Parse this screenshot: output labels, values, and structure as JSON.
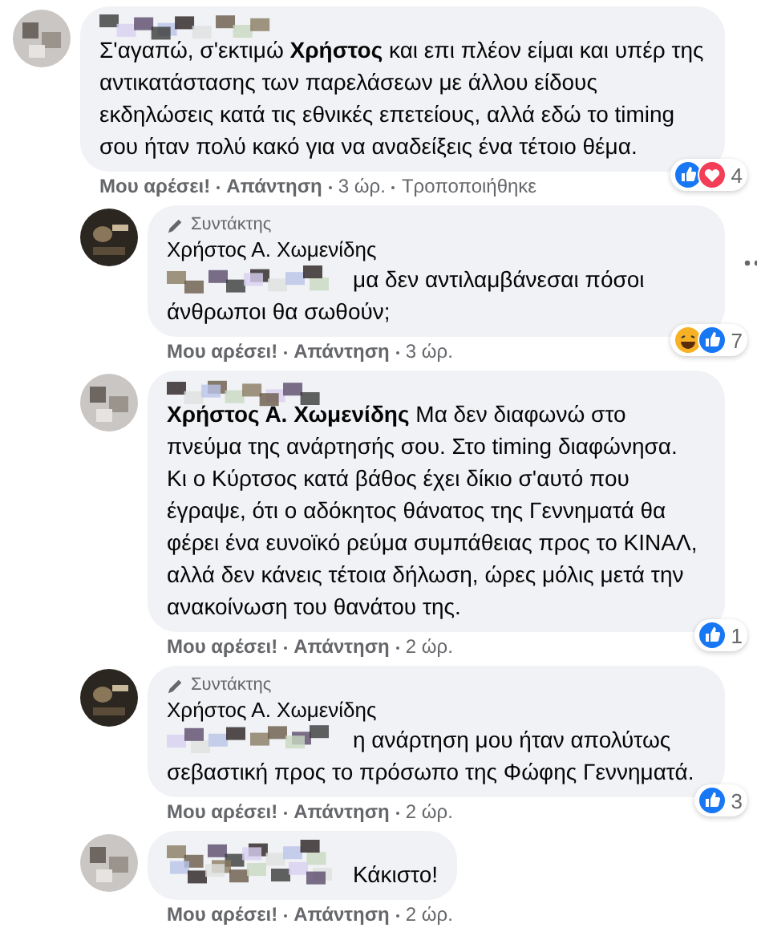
{
  "comments": [
    {
      "avatar_redacted": true,
      "author_redacted": true,
      "text": [
        {
          "redacted_prefix": false,
          "text": "Σ'αγαπώ, σ'εκτιμώ **Χρήστος** και επι πλέον είμαι και υπέρ της αντικατάστασης των παρελάσεων με άλλου είδους εκδηλώσεις κατά τις εθνικές επετείους, αλλά εδώ το timing σου ήταν πολύ κακό για να αναδείξεις ένα τέτοιο θέμα."
        }
      ],
      "reactions": [
        {
          "kind": "like"
        },
        {
          "kind": "love"
        }
      ],
      "reaction_count": "4",
      "actions": [
        "Μου αρέσει!",
        "Απάντηση"
      ],
      "time": "3 ώρ.",
      "edited": "Τροποποιήθηκε",
      "children": [
        {
          "avatar_redacted": false,
          "badge": "Συντάκτης",
          "author": "Χρήστος Α. Χωμενίδης",
          "text": [
            {
              "redacted_prefix": true,
              "text": "μα δεν αντιλαμβάνεσαι πόσοι"
            },
            {
              "redacted_prefix": false,
              "text": "άνθρωποι θα σωθούν;"
            }
          ],
          "reactions": [
            {
              "kind": "haha"
            },
            {
              "kind": "like"
            }
          ],
          "reaction_count": "7",
          "actions": [
            "Μου αρέσει!",
            "Απάντηση"
          ],
          "time": "3 ώρ.",
          "more_menu": true
        },
        {
          "avatar_redacted": true,
          "author_redacted": true,
          "text": [
            {
              "redacted_prefix": false,
              "text": "**Χρήστος Α. Χωμενίδης** Μα δεν διαφωνώ στο πνεύμα της ανάρτησής σου. Στο timing διαφώνησα."
            },
            {
              "redacted_prefix": false,
              "text": "Κι ο Κύρτσος κατά βάθος έχει δίκιο σ'αυτό που έγραψε, ότι ο αδόκητος θάνατος της Γεννηματά θα φέρει ένα ευνοϊκό ρεύμα συμπάθειας προς το ΚΙΝΑΛ, αλλά δεν κάνεις τέτοια δήλωση, ώρες μόλις μετά την ανακοίνωση του θανάτου της."
            }
          ],
          "reactions": [
            {
              "kind": "like"
            }
          ],
          "reaction_count": "1",
          "actions": [
            "Μου αρέσει!",
            "Απάντηση"
          ],
          "time": "2 ώρ."
        },
        {
          "avatar_redacted": false,
          "badge": "Συντάκτης",
          "author": "Χρήστος Α. Χωμενίδης",
          "text": [
            {
              "redacted_prefix": true,
              "text": "η ανάρτηση μου ήταν απολύτως"
            },
            {
              "redacted_prefix": false,
              "text": "σεβαστική προς το πρόσωπο της Φώφης Γεννηματά."
            }
          ],
          "reactions": [
            {
              "kind": "like"
            }
          ],
          "reaction_count": "3",
          "actions": [
            "Μου αρέσει!",
            "Απάντηση"
          ],
          "time": "2 ώρ."
        },
        {
          "avatar_redacted": true,
          "author_redacted": true,
          "text": [
            {
              "redacted_prefix": true,
              "text": "Κάκιστο!"
            }
          ],
          "actions": [
            "Μου αρέσει!",
            "Απάντηση"
          ],
          "time": "2 ώρ."
        }
      ]
    }
  ]
}
